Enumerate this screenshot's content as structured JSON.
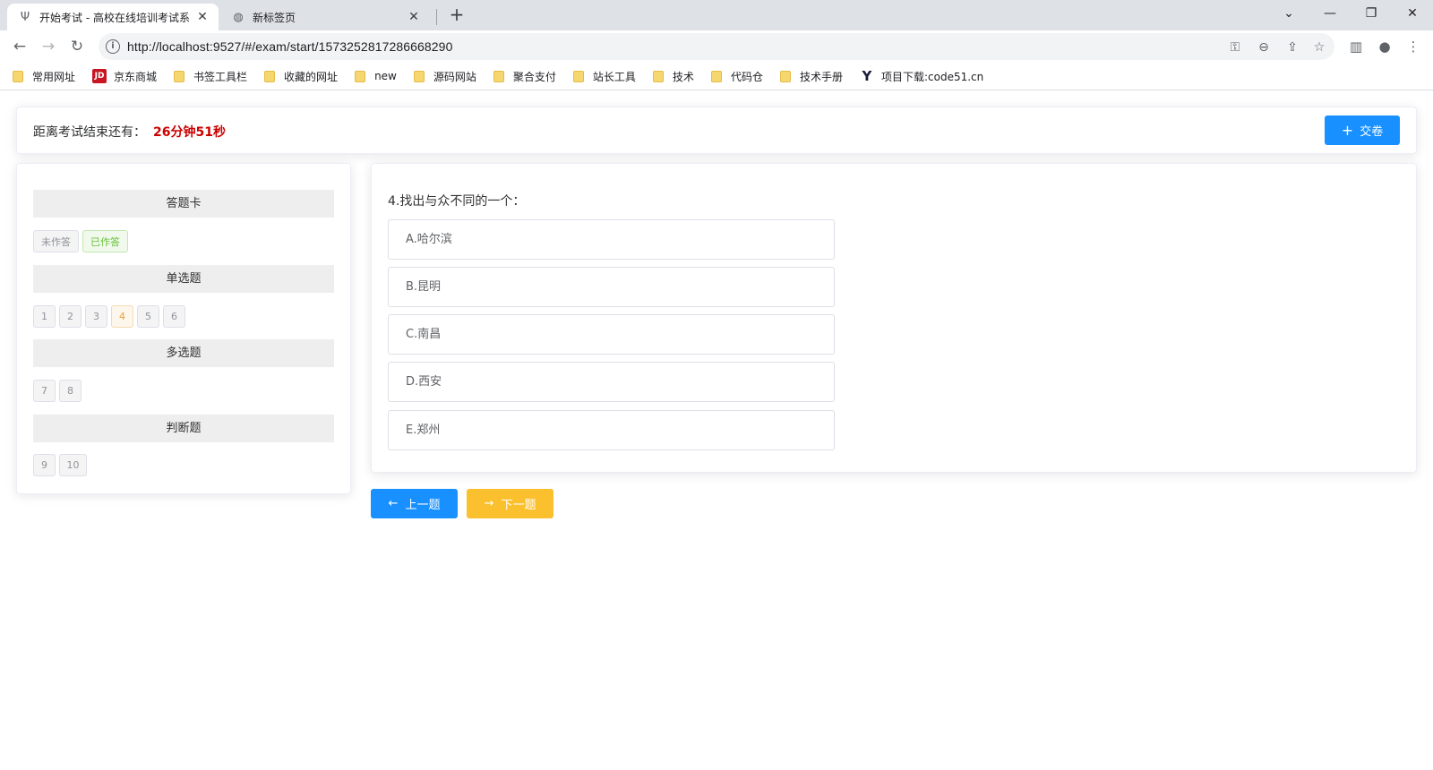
{
  "browser": {
    "tabs": [
      {
        "title": "开始考试 - 高校在线培训考试系统",
        "close": "✕",
        "favicon": "sprout-icon"
      },
      {
        "title": "新标签页",
        "close": "✕",
        "favicon": "globe-icon"
      }
    ],
    "new_tab": "+",
    "window": {
      "dropdown": "⌄",
      "minimize": "—",
      "restore": "❐",
      "close": "✕"
    },
    "nav": {
      "back": "←",
      "forward": "→",
      "reload": "↻"
    },
    "url": "http://localhost:9527/#/exam/start/1573252817286668290",
    "bookmarks": [
      {
        "label": "常用网址",
        "icon": "folder"
      },
      {
        "label": "京东商城",
        "icon": "jd",
        "icon_text": "JD"
      },
      {
        "label": "书签工具栏",
        "icon": "folder"
      },
      {
        "label": "收藏的网址",
        "icon": "folder"
      },
      {
        "label": "new",
        "icon": "folder"
      },
      {
        "label": "源码网站",
        "icon": "folder"
      },
      {
        "label": "聚合支付",
        "icon": "folder"
      },
      {
        "label": "站长工具",
        "icon": "folder"
      },
      {
        "label": "技术",
        "icon": "folder"
      },
      {
        "label": "代码仓",
        "icon": "folder"
      },
      {
        "label": "技术手册",
        "icon": "folder"
      },
      {
        "label": "项目下载:code51.cn",
        "icon": "y",
        "icon_text": "Y"
      }
    ]
  },
  "exam": {
    "timer_label": "距离考试结束还有：",
    "timer_value": "26分钟51秒",
    "submit_label": "交卷",
    "answer_card": {
      "title": "答题卡",
      "legend": {
        "unanswered": "未作答",
        "answered": "已作答"
      },
      "sections": [
        {
          "title": "单选题",
          "numbers": [
            "1",
            "2",
            "3",
            "4",
            "5",
            "6"
          ],
          "current": "4"
        },
        {
          "title": "多选题",
          "numbers": [
            "7",
            "8"
          ]
        },
        {
          "title": "判断题",
          "numbers": [
            "9",
            "10"
          ]
        }
      ]
    },
    "question": {
      "text": "4.找出与众不同的一个：",
      "options": [
        "A.哈尔滨",
        "B.昆明",
        "C.南昌",
        "D.西安",
        "E.郑州"
      ]
    },
    "prev_label": "上一题",
    "next_label": "下一题",
    "colors": {
      "primary": "#1890ff",
      "warning": "#fbc02d",
      "timer": "#cc0000"
    }
  }
}
